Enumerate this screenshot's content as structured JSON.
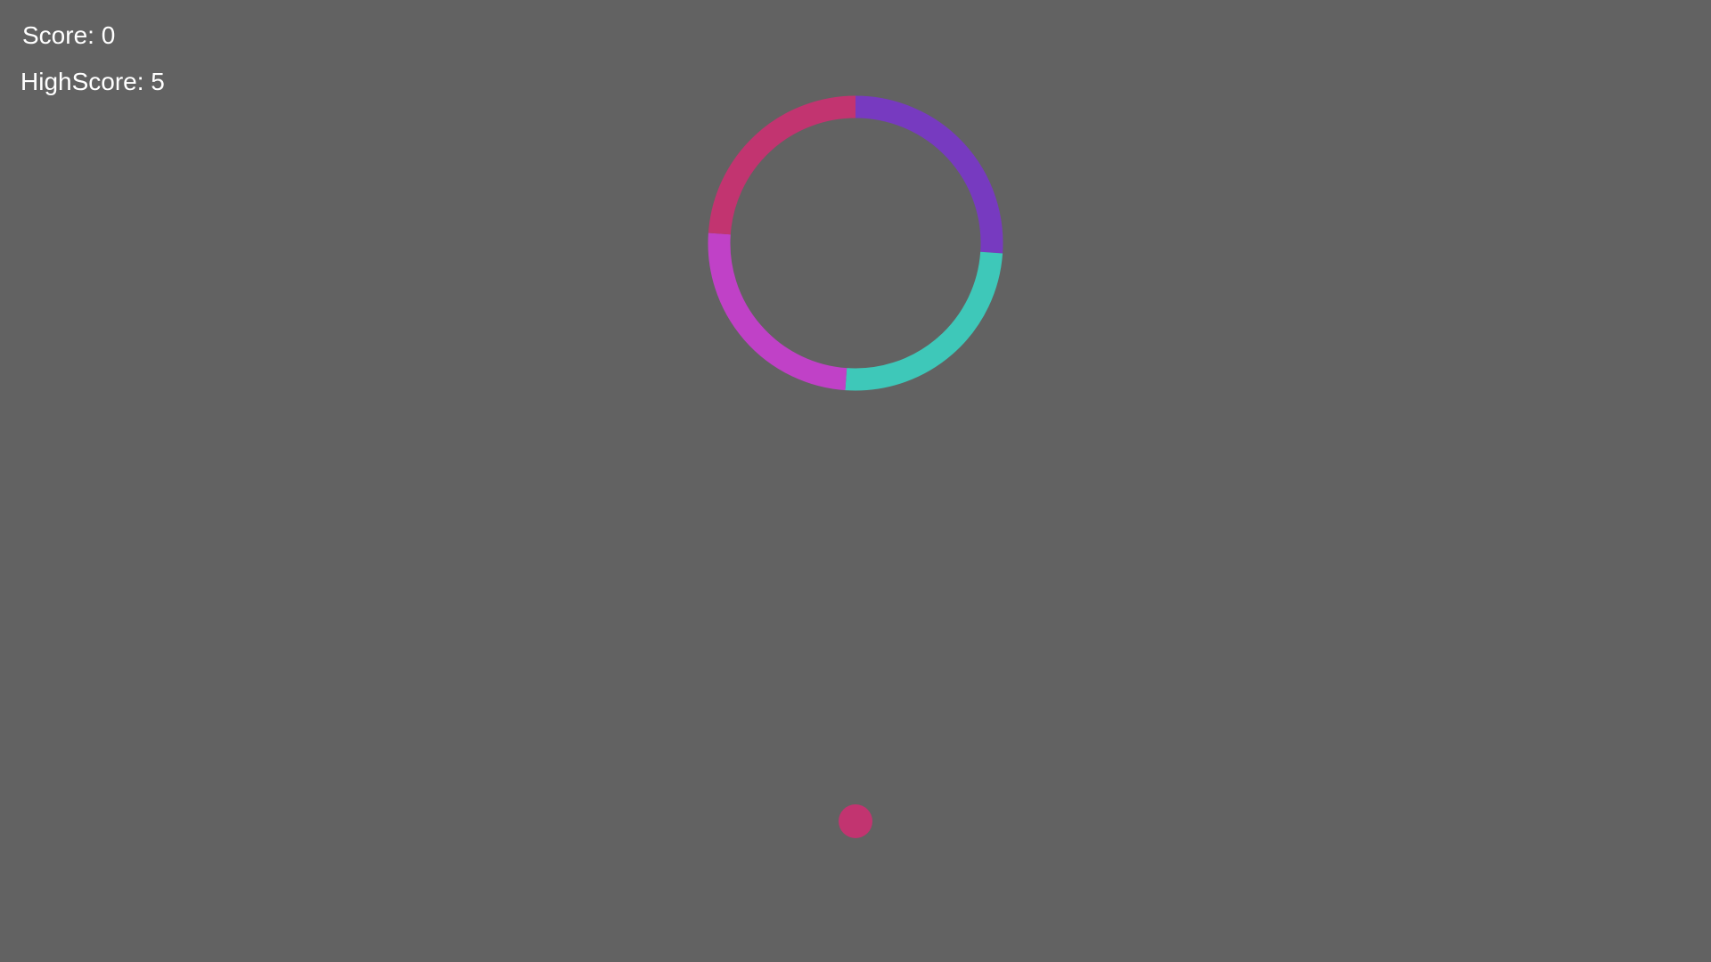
{
  "hud": {
    "score_text": "Score: 0",
    "highscore_text": "HighScore: 5"
  },
  "colors": {
    "background": "#626262",
    "pink": "#c23470",
    "purple": "#773ac0",
    "teal": "#3ec8b9",
    "magenta": "#c041c7",
    "ball": "#c23470"
  },
  "ring": {
    "segments": [
      {
        "name": "ring-segment-purple",
        "color": "#773ac0"
      },
      {
        "name": "ring-segment-teal",
        "color": "#3ec8b9"
      },
      {
        "name": "ring-segment-magenta",
        "color": "#c041c7"
      },
      {
        "name": "ring-segment-pink",
        "color": "#c23470"
      }
    ]
  }
}
